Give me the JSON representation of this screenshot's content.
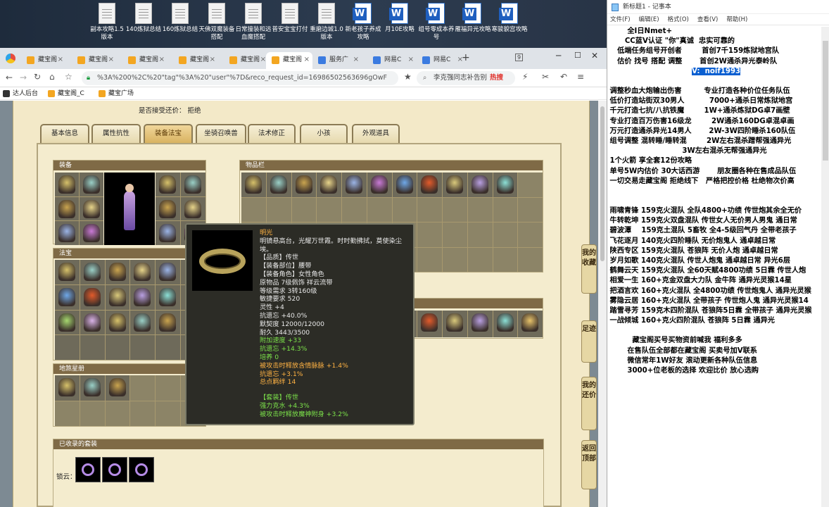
{
  "desktop": {
    "icons": [
      {
        "label": "副本攻略1.5版本",
        "type": "text"
      },
      {
        "label": "140炼狱总结",
        "type": "text"
      },
      {
        "label": "160炼狱总结",
        "type": "text"
      },
      {
        "label": "天佛双魔装备搭配",
        "type": "text"
      },
      {
        "label": "日常撞装和远血魔搭配",
        "type": "text"
      },
      {
        "label": "普安宝宝打付",
        "type": "text"
      },
      {
        "label": "重磨边城1.0版本",
        "type": "text"
      },
      {
        "label": "新老孩子养成攻略",
        "type": "word"
      },
      {
        "label": "月10E攻略",
        "type": "word"
      },
      {
        "label": "组号零成本养号",
        "type": "word"
      },
      {
        "label": "雁福异光攻略",
        "type": "word"
      },
      {
        "label": "寒骏貌宫攻略",
        "type": "word"
      }
    ]
  },
  "browser": {
    "tabs": [
      {
        "label": "藏宝阁"
      },
      {
        "label": "藏宝阁"
      },
      {
        "label": "藏宝阁"
      },
      {
        "label": "藏宝阁"
      },
      {
        "label": "藏宝阁"
      },
      {
        "label": "藏宝阁"
      },
      {
        "label": "服务广"
      },
      {
        "label": "网易C"
      },
      {
        "label": "网易C"
      }
    ],
    "tab_count": "9",
    "url": "%3A%200%2C%20\"tag\"%3A%20\"user\"%7D&reco_request_id=16986502563696gOwF",
    "search_text": "李克强同志补告别",
    "hot_label": "热搜",
    "bookmarks": [
      "达人后台",
      "藏宝阁_C",
      "藏宝广场"
    ]
  },
  "game": {
    "accept_change_label": "是否接受还价：",
    "accept_change_value": "拒绝",
    "tabs": [
      "基本信息",
      "属性抗性",
      "装备法宝",
      "坐骑召唤兽",
      "法术修正",
      "小孩",
      "外观道具"
    ],
    "active_tab": "装备法宝",
    "sections": {
      "equipment": "装备",
      "items": "物品栏",
      "treasures": "法宝",
      "fengdu": "地煞星册",
      "collected_sets": "已收录的套装",
      "suit_label": "锁云："
    },
    "side_buttons": [
      "我的收藏",
      "足迹",
      "我的还价",
      "返回顶部"
    ],
    "tooltip": {
      "name": "明光",
      "desc": "明镜悬高台，光耀万世霞。时时勤拂拭，莫使染尘埃。",
      "lines": [
        {
          "t": "【品质】传世",
          "c": ""
        },
        {
          "t": "【装备部位】腰带",
          "c": ""
        },
        {
          "t": "【装备角色】女性角色",
          "c": ""
        },
        {
          "t": "原物品 7级佩饰 祥云流带",
          "c": ""
        },
        {
          "t": "等级需求 3转160级",
          "c": ""
        },
        {
          "t": "敏捷要求 520",
          "c": ""
        },
        {
          "t": "灵性 +4",
          "c": ""
        },
        {
          "t": "抗遗忘 +40.0%",
          "c": ""
        },
        {
          "t": "默契度 12000/12000",
          "c": ""
        },
        {
          "t": "耐久 3443/3500",
          "c": ""
        },
        {
          "t": "附加速度 +33",
          "c": "grn"
        },
        {
          "t": "抗遗忘 +14.3%",
          "c": "grn"
        },
        {
          "t": "培养 0",
          "c": "grn"
        },
        {
          "t": "被攻击时释放含情脉脉 +1.4%",
          "c": "org"
        },
        {
          "t": "抗遗忘 +3.1%",
          "c": "org"
        },
        {
          "t": "总点羁绊  14",
          "c": "org"
        },
        {
          "t": "",
          "c": ""
        },
        {
          "t": "【套装】传世",
          "c": "grn"
        },
        {
          "t": "强力克水 +4.3%",
          "c": "grn"
        },
        {
          "t": "被攻击时释放魔神附身 +3.2%",
          "c": "grn"
        }
      ]
    }
  },
  "notepad": {
    "title": "新标题1 - 记事本",
    "menu": [
      "文件(F)",
      "编辑(E)",
      "格式(O)",
      "查看(V)",
      "帮助(H)"
    ],
    "lines": [
      "        全I日Nmet+",
      "       CC蓝V认证 \"你\"真诚  忠实可靠的",
      "    低端任务组号开创者        首创7千159炼狱地宫队",
      "    估价 找号 搭配 调整       首创2W通杀异光泰岭队",
      "                   V:  noif1993",
      "",
      " 调整秒血大炮输出伤害         专业打造各种价位任务队伍",
      " 低价打造站街双30男人          7000+通杀日常炼狱地宫",
      " 千元打造七抗/八抗铁魔        1W+通杀炼狱DG卓7画壁",
      " 专业打造百万伤害16级龙        2W通杀160DG卓混卓画",
      " 万元打造通杀异光14男人       2W-3W四阶睡杀160队伍",
      " 组号调整 混转睡/睡转混        2W左右混杀蹭帮强通异光",
      "                              3W左右混杀无帮强通异光",
      " 1个火箭 享全套12份攻略",
      " 单号5W内估价 30大话西游       朋友圈各种在售成品队伍",
      " 一切交易走藏宝阁 拒绝线下   严格把控价格 杜绝物次价高",
      "",
      "",
      " 雨啸青锋 159克火混队 全队4800+功绩 传世炮其余全无价",
      " 牛转乾坤 159克火双盘混队 传世女人无价男人男鬼 通日常",
      " 碧波潭    159克土混队 5畜牧 全4-5级回气丹 全带老孩子",
      " 飞花逐月 140克火四阶睡队 无价炮鬼人 通卓越日常",
      " 陕西专区 159克火混队 苍狼阵 无价人炮 通卓越日常",
      " 岁月如歌 140克火混队 传世人炮鬼 通卓越日常 异光6层",
      " 鹤舞云天 159克火混队 全60天赋4800功绩 5日霖 传世人炮",
      " 相爱一生 160+克金双盘大力队 金牛阵 通异光灵猴14星",
      " 把酒言欢 160+克火混队 全4800功绩 传世炮鬼人 通异光灵猴",
      " 雾隐云居 160+克火混队 全带孩子 传世炮人鬼 通异光灵猴14",
      " 踏雪寻芳 159克木四阶混队 苍狼阵5日霖 全带孩子 通异光灵猴",
      " 一战倾城 160+克火四阶混队 苍狼阵 5日霖 通异光",
      "",
      "          藏宝阁买号买物资前喊我 福利多多",
      "        在售队伍全部都在藏宝阁 买卖号加V联系",
      "        微信常年1W好友 滚动更新各种队伍信息",
      "        3000+位老板的选择 欢迎比价 放心选购"
    ]
  }
}
